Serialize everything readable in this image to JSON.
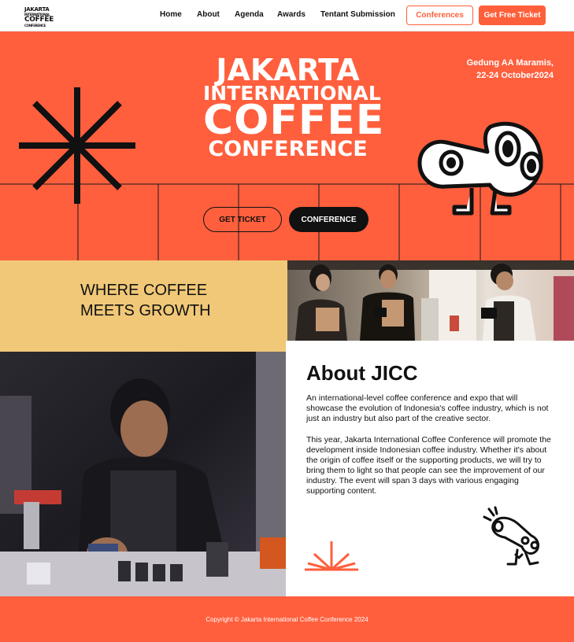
{
  "brand": {
    "logo_lines": [
      "JAKARTA",
      "INTERNATIONAL",
      "COFFEE",
      "CONFERENCE"
    ],
    "accent": "#ff5f3d",
    "accent_light": "#f0c877"
  },
  "nav": {
    "links": [
      "Home",
      "About",
      "Agenda",
      "Awards",
      "Tentant Submission"
    ],
    "conferences_button": "Conferences",
    "ticket_button": "Get Free Ticket"
  },
  "hero": {
    "title_line1": "JAKARTA",
    "title_line2": "INTERNATIONAL",
    "title_line3": "COFFEE",
    "title_line4": "CONFERENCE",
    "venue_line1": "Gedung AA Maramis,",
    "venue_line2": "22-24 October2024",
    "get_ticket_button": "GET TICKET",
    "conference_button": "CONFERENCE",
    "icons": [
      "starburst-icon",
      "coffee-bean-character-icon"
    ]
  },
  "tagline": {
    "line1": "WHERE COFFEE",
    "line2": "MEETS GROWTH"
  },
  "about": {
    "title": "About JICC",
    "paragraph1": "An international-level coffee conference and expo that will showcase the evolution of Indonesia's coffee industry, which is not just an industry but also part of the creative sector.",
    "paragraph2": "This year, Jakarta International Coffee Conference will promote the development inside Indonesian coffee industry. Whether it's about the origin of coffee itself or the supporting products, we will try to bring them to light so that people can see the improvement of our industry. The event will span 3 days with various engaging supporting content.",
    "icons": [
      "sunrise-icon",
      "coffee-character-icon"
    ]
  },
  "footer": {
    "copyright": "Copyright © Jakarta International Coffee Conference 2024"
  }
}
